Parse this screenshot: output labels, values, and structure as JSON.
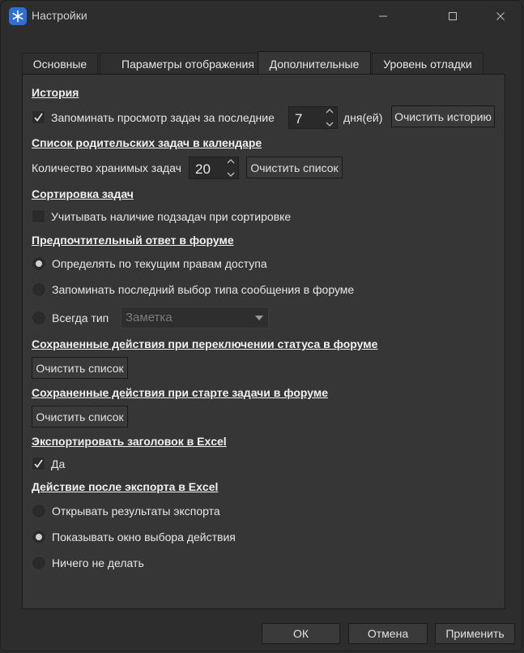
{
  "window": {
    "title": "Настройки",
    "icon": "app-snowflake-icon",
    "accent": "#2f6fd6"
  },
  "tabs": [
    {
      "label": "Основные",
      "active": false
    },
    {
      "label": "Параметры отображения",
      "active": false
    },
    {
      "label": "Дополнительные",
      "active": true
    },
    {
      "label": "Уровень отладки",
      "active": false
    }
  ],
  "history": {
    "title": "История",
    "remember_label": "Запоминать просмотр задач за последние",
    "remember_checked": true,
    "days_value": "7",
    "days_unit": "дня(ей)",
    "clear_button": "Очистить историю"
  },
  "parent_list": {
    "title": "Список родительских задач в календаре",
    "count_label": "Количество хранимых задач",
    "count_value": "20",
    "clear_button": "Очистить список"
  },
  "sorting": {
    "title": "Сортировка задач",
    "subtasks_label": "Учитывать наличие подзадач при сортировке",
    "subtasks_checked": false
  },
  "forum_reply": {
    "title": "Предпочтительный ответ в форуме",
    "options": [
      {
        "label": "Определять по текущим правам доступа",
        "selected": true
      },
      {
        "label": "Запоминать последний выбор типа сообщения в форуме",
        "selected": false
      },
      {
        "label": "Всегда тип",
        "selected": false
      }
    ],
    "type_select": "Заметка"
  },
  "status_actions": {
    "title": "Сохраненные действия при переключении статуса в форуме",
    "clear_button": "Очистить список"
  },
  "start_actions": {
    "title": "Сохраненные действия при старте задачи в форуме",
    "clear_button": "Очистить список"
  },
  "excel_header": {
    "title": "Экспортировать заголовок в Excel",
    "yes_label": "Да",
    "yes_checked": true
  },
  "excel_after": {
    "title": "Действие после экспорта в Excel",
    "options": [
      {
        "label": "Открывать результаты экспорта",
        "selected": false
      },
      {
        "label": "Показывать окно выбора действия",
        "selected": true
      },
      {
        "label": "Ничего не делать",
        "selected": false
      }
    ]
  },
  "footer": {
    "ok": "ОК",
    "cancel": "Отмена",
    "apply": "Применить"
  }
}
